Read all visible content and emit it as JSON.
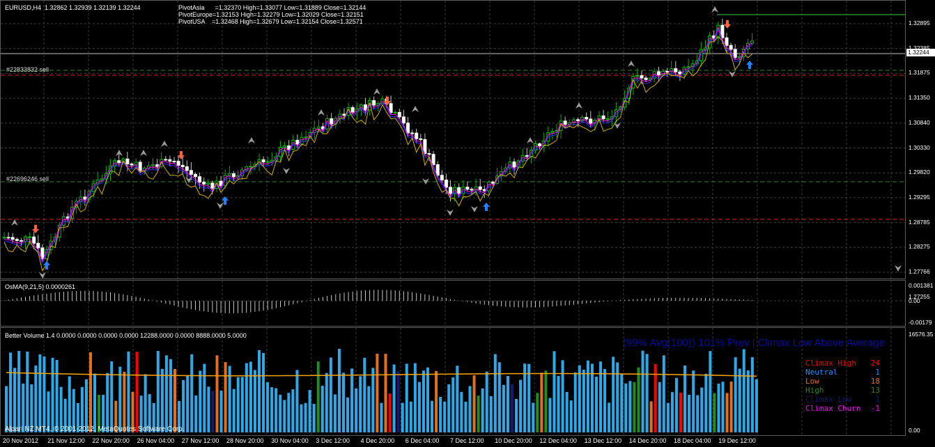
{
  "main": {
    "symbol_info": "EURUSD,H4  1.32862 1.32939 1.32139 1.32244",
    "pivots": [
      "PivotAsia      =1.32370 High=1.33077 Low=1.31889 Close=1.32144",
      "PivotEurope=1.32153 High=1.32279 Low=1.32029 Close=1.32151",
      "PivotUSA    =1.32468 High=1.32679 Low=1.32154 Close=1.32571"
    ],
    "order_labels": [
      "#22833832 sell",
      "#22696246 sell"
    ],
    "price_ticks": [
      "1.32895",
      "1.32385",
      "1.31875",
      "1.31350",
      "1.30840",
      "1.30330",
      "1.29820",
      "1.29295",
      "1.28785",
      "1.28275",
      "1.27766",
      "1.27255"
    ],
    "current_price": "1.32244"
  },
  "osma": {
    "label": "OsMA(9,21,5) 0.0000261",
    "ticks": [
      "0.001381",
      "0.00",
      "-0.00179"
    ]
  },
  "volume": {
    "label": "Better Volume 1.4 0.0000 0.0000 0.0000 0.0000 12288.0000 0.0000 8888.0000 5.0000",
    "headline": "(99% Avg(100)) 101% Prev | Climax Low Above Average",
    "top_tick": "16576.35",
    "bottom_tick": "0.00",
    "legend": [
      {
        "name": "Climax High",
        "value": "24",
        "color": "#ff0000"
      },
      {
        "name": "Neutral",
        "value": "1",
        "color": "#1e90ff"
      },
      {
        "name": "Low",
        "value": "18",
        "color": "#e07020"
      },
      {
        "name": "High",
        "value": "13",
        "color": "#228b22"
      },
      {
        "name": "Climax Low",
        "value": "1",
        "color": "#191970"
      },
      {
        "name": "Climax Churn",
        "value": "-1",
        "color": "#ff00ff"
      }
    ],
    "copyright": "Alpari NZ MT4, © 2001-2012, MetaQuotes Software Corp."
  },
  "time_axis": [
    "20 Nov 2012",
    "21 Nov 12:00",
    "22 Nov 20:00",
    "26 Nov 04:00",
    "27 Nov 12:00",
    "28 Nov 20:00",
    "30 Nov 04:00",
    "3 Dec 12:00",
    "4 Dec 20:00",
    "6 Dec 04:00",
    "7 Dec 12:00",
    "10 Dec 20:00",
    "12 Dec 04:00",
    "13 Dec 12:00",
    "14 Dec 20:00",
    "18 Dec 04:00",
    "19 Dec 12:00"
  ],
  "colors": {
    "bull": "#00c000",
    "bear": "#ffffff",
    "grid": "#404040",
    "volume_neutral": "#2fa8e8",
    "volume_avg": "#ffa500"
  }
}
